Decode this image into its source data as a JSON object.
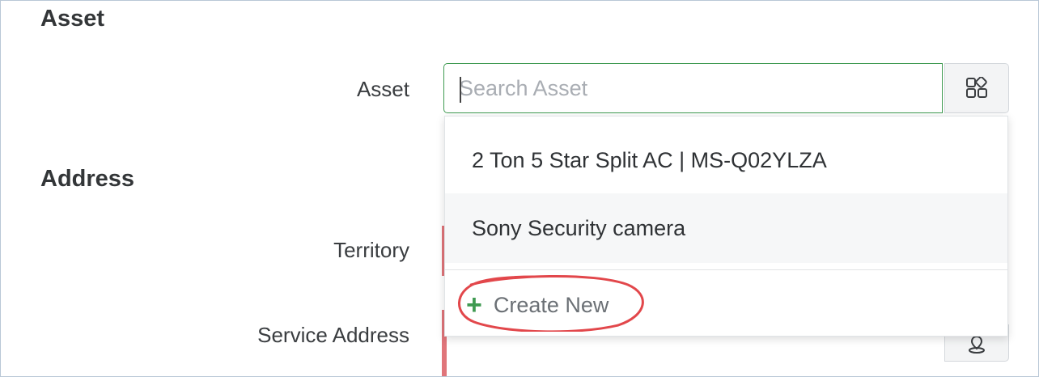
{
  "sections": {
    "asset_heading": "Asset",
    "address_heading": "Address"
  },
  "fields": {
    "asset_label": "Asset",
    "territory_label": "Territory",
    "service_address_label": "Service Address"
  },
  "search": {
    "value": "",
    "placeholder": "Search Asset"
  },
  "icons": {
    "lookup": "lookup-grid-icon",
    "create": "plus-icon",
    "location": "location-pin-icon"
  },
  "dropdown": {
    "items": [
      {
        "label": "2 Ton 5 Star Split AC | MS-Q02YLZA"
      },
      {
        "label": "Sony Security camera"
      }
    ],
    "create_new_label": "Create New"
  },
  "colors": {
    "accent_green": "#3f9a51",
    "required_red": "#e0757a",
    "annotation_red": "#e2474b"
  }
}
